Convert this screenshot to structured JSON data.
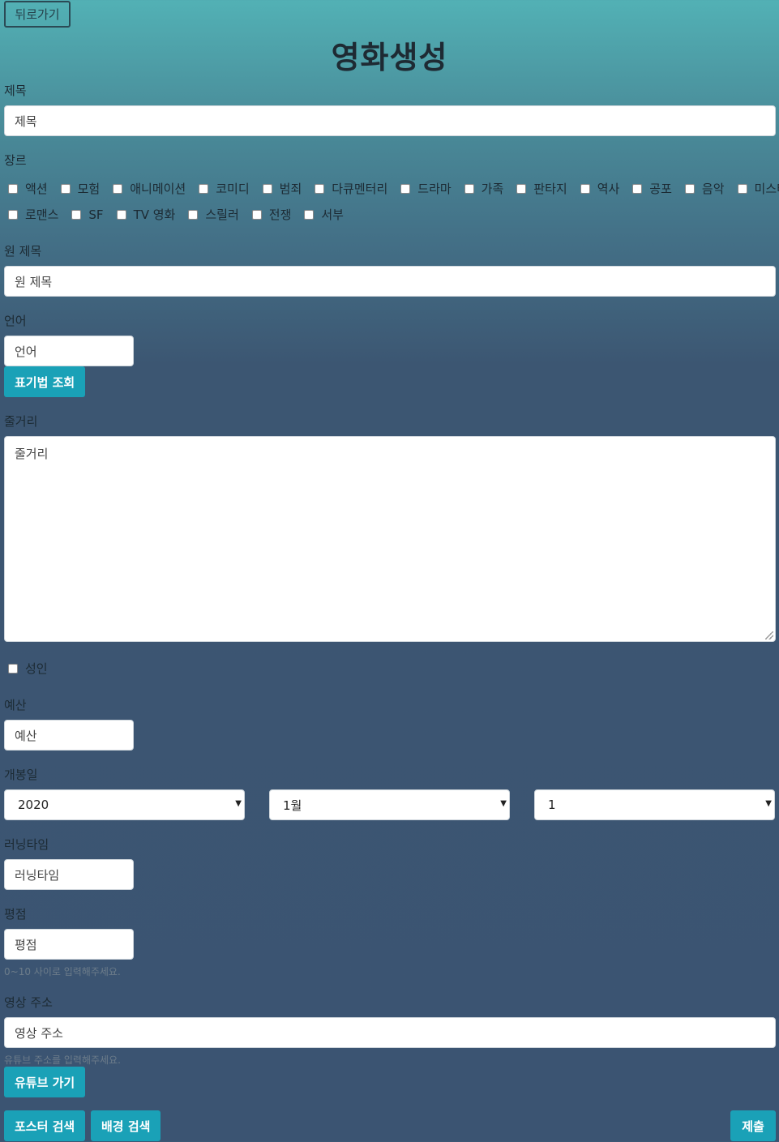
{
  "back_label": "뒤로가기",
  "title": "영화생성",
  "fields": {
    "title_label": "제목",
    "title_placeholder": "제목",
    "genre_label": "장르",
    "original_title_label": "원 제목",
    "original_title_placeholder": "원 제목",
    "language_label": "언어",
    "language_placeholder": "언어",
    "notation_button": "표기법 조회",
    "plot_label": "줄거리",
    "plot_placeholder": "줄거리",
    "adult_label": "성인",
    "budget_label": "예산",
    "budget_placeholder": "예산",
    "release_label": "개봉일",
    "release_year": "2020",
    "release_month": "1월",
    "release_day": "1",
    "runtime_label": "러닝타임",
    "runtime_placeholder": "러닝타임",
    "rating_label": "평점",
    "rating_placeholder": "평점",
    "rating_help": "0~10 사이로 입력해주세요.",
    "video_label": "영상 주소",
    "video_placeholder": "영상 주소",
    "video_help": "유튜브 주소를 입력해주세요.",
    "youtube_button": "유튜브 가기"
  },
  "genres_row1": [
    "액션",
    "모험",
    "애니메이션",
    "코미디",
    "범죄",
    "다큐멘터리",
    "드라마",
    "가족",
    "판타지",
    "역사",
    "공포",
    "음악",
    "미스터리"
  ],
  "genres_row2": [
    "로맨스",
    "SF",
    "TV 영화",
    "스릴러",
    "전쟁",
    "서부"
  ],
  "actions": {
    "poster_search": "포스터 검색",
    "backdrop_search": "배경 검색",
    "submit": "제출"
  }
}
